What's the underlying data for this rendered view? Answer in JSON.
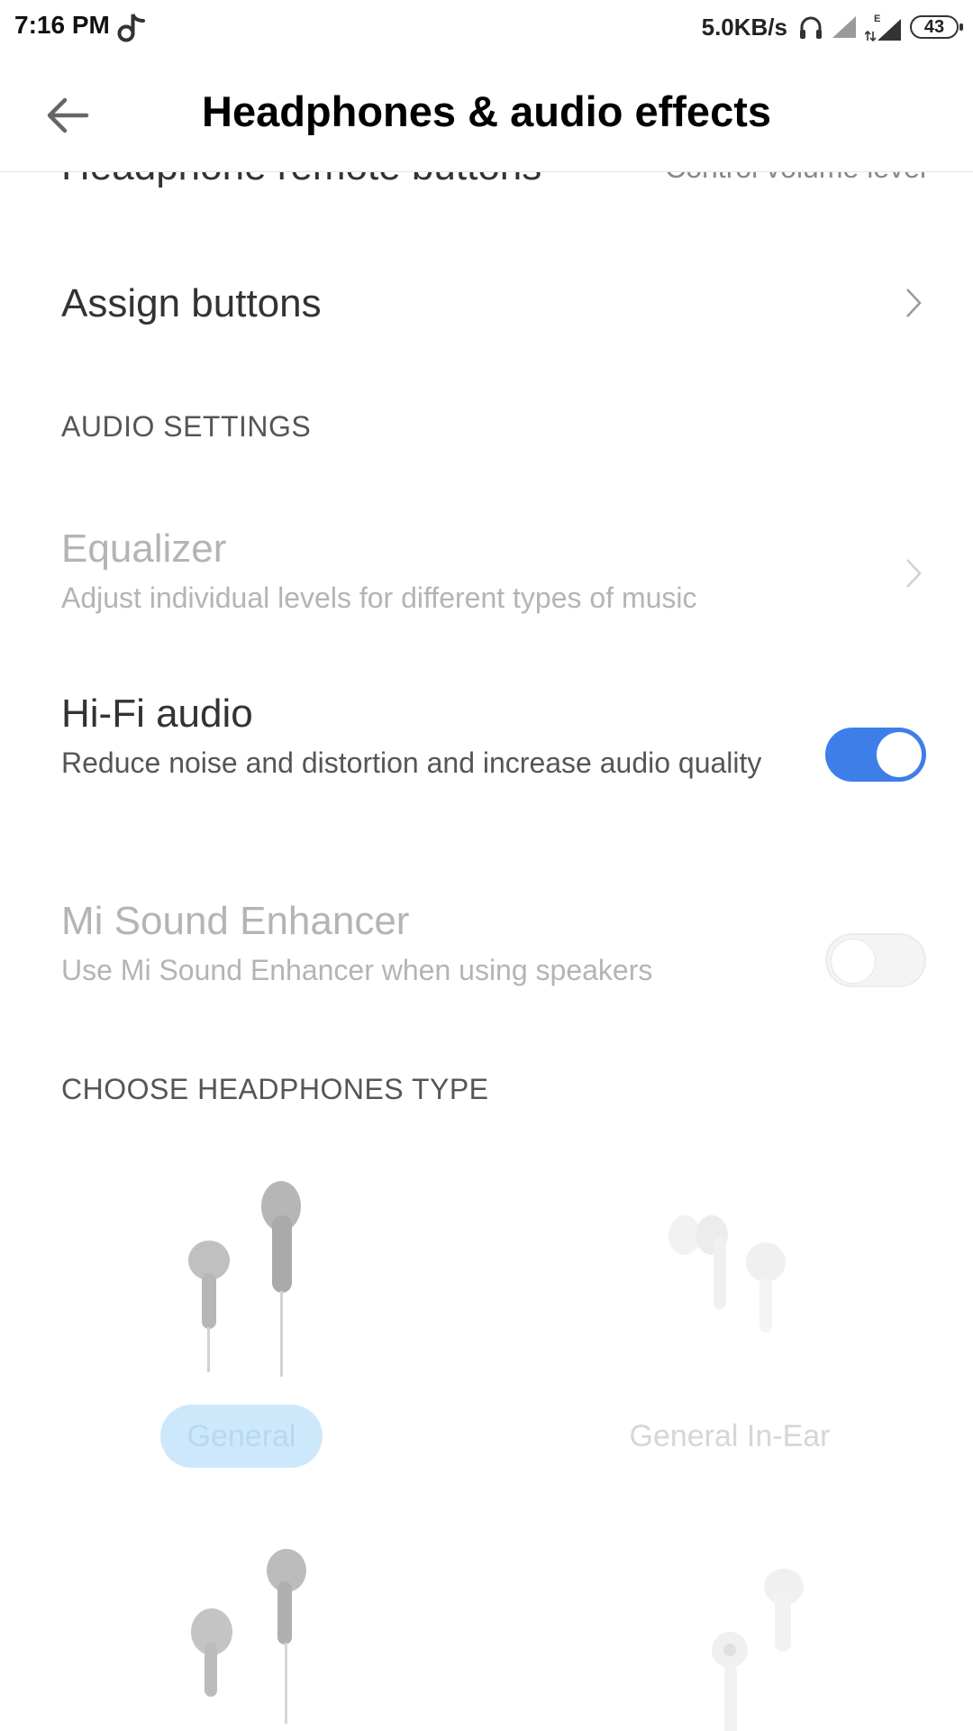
{
  "status_bar": {
    "time": "7:16 PM",
    "network_speed": "5.0KB/s",
    "battery": "43",
    "icons": [
      "tiktok-icon",
      "headphones-icon",
      "signal-icon",
      "signal-e-icon",
      "battery-icon"
    ]
  },
  "header": {
    "title": "Headphones & audio effects",
    "back_icon": "arrow-left-icon"
  },
  "settings": {
    "remote_buttons": {
      "label": "Headphone remote buttons",
      "value": "Control volume level"
    },
    "assign_buttons": {
      "label": "Assign buttons"
    },
    "audio_section": {
      "header": "AUDIO SETTINGS"
    },
    "equalizer": {
      "label": "Equalizer",
      "description": "Adjust individual levels for different types of music",
      "enabled": false
    },
    "hifi": {
      "label": "Hi-Fi audio",
      "description": "Reduce noise and distortion and increase audio quality",
      "on": true
    },
    "mi_sound": {
      "label": "Mi Sound Enhancer",
      "description": "Use Mi Sound Enhancer when using speakers",
      "on": false,
      "enabled": false
    },
    "headphones_section": {
      "header": "CHOOSE HEADPHONES TYPE"
    }
  },
  "headphone_types": [
    {
      "label": "General",
      "selected": true
    },
    {
      "label": "General In-Ear",
      "selected": false
    }
  ],
  "colors": {
    "accent": "#3e7ee8",
    "selected_chip": "#cde8fb"
  }
}
